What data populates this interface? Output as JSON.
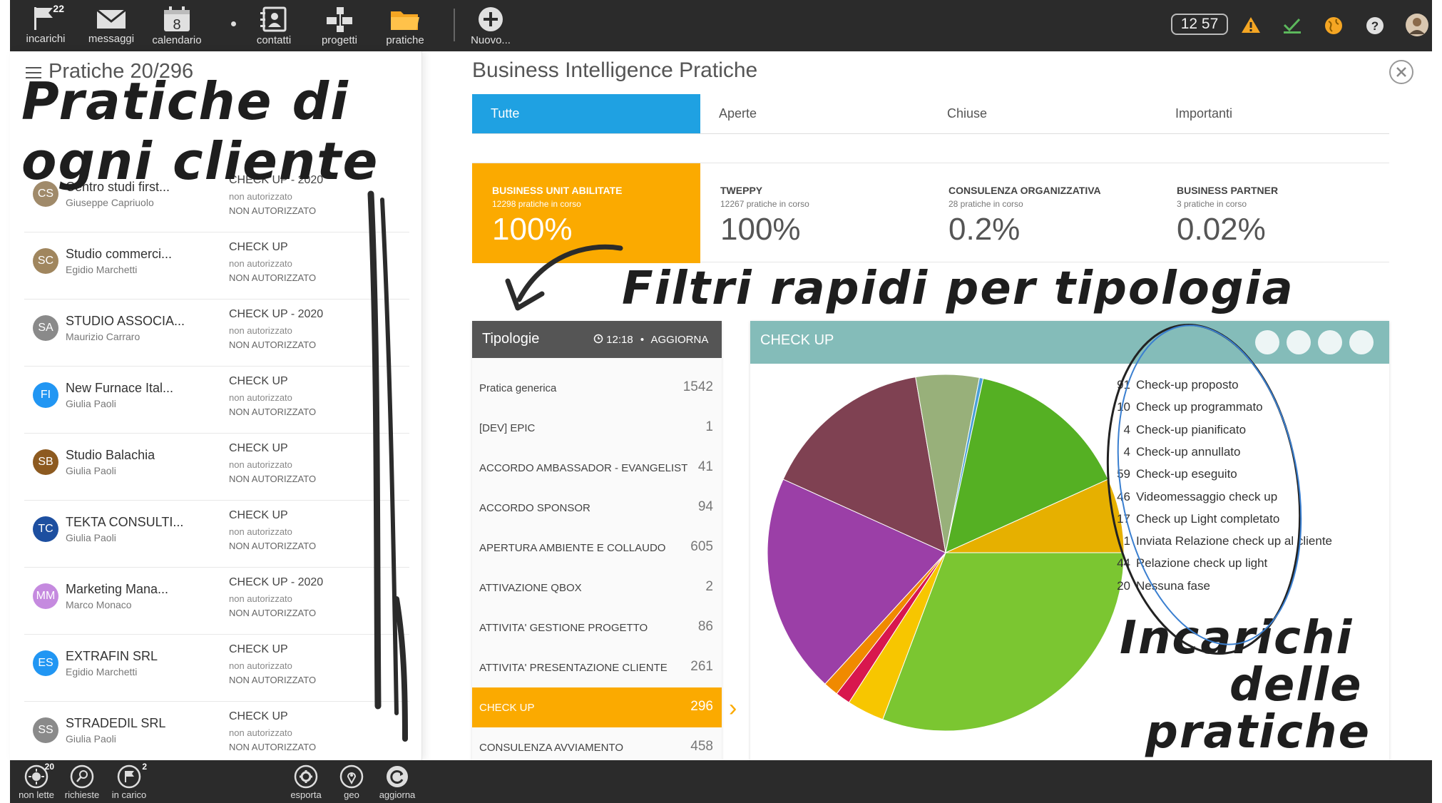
{
  "topbar": {
    "items": [
      {
        "label": "incarichi",
        "icon": "flag-icon",
        "badge": "22"
      },
      {
        "label": "messaggi",
        "icon": "envelope-icon"
      },
      {
        "label": "calendario",
        "icon": "calendar-icon",
        "day": "8"
      },
      {
        "label": "contatti",
        "icon": "contacts-icon"
      },
      {
        "label": "progetti",
        "icon": "projects-icon"
      },
      {
        "label": "pratiche",
        "icon": "folder-icon"
      },
      {
        "label": "Nuovo...",
        "icon": "plus-icon"
      }
    ],
    "clock": "12 57"
  },
  "left": {
    "title": "Pratiche 20/296",
    "clients": [
      {
        "initials": "CS",
        "color": "#a08a6a",
        "name": "Centro studi first...",
        "contact": "Giuseppe Capriuolo",
        "type": "CHECK UP - 2020",
        "sub": "non autorizzato",
        "status": "NON AUTORIZZATO"
      },
      {
        "initials": "SC",
        "color": "#a0865e",
        "name": "Studio commerci...",
        "contact": "Egidio Marchetti",
        "type": "CHECK UP",
        "sub": "non autorizzato",
        "status": "NON AUTORIZZATO"
      },
      {
        "initials": "SA",
        "color": "#8a8a8a",
        "name": "STUDIO ASSOCIA...",
        "contact": "Maurizio Carraro",
        "type": "CHECK UP - 2020",
        "sub": "non autorizzato",
        "status": "NON AUTORIZZATO"
      },
      {
        "initials": "FI",
        "color": "#2196f3",
        "name": "New Furnace Ital...",
        "contact": "Giulia Paoli",
        "type": "CHECK UP",
        "sub": "non autorizzato",
        "status": "NON AUTORIZZATO"
      },
      {
        "initials": "SB",
        "color": "#8d5a20",
        "name": "Studio Balachia",
        "contact": "Giulia Paoli",
        "type": "CHECK UP",
        "sub": "non autorizzato",
        "status": "NON AUTORIZZATO"
      },
      {
        "initials": "TC",
        "color": "#1d4fa0",
        "name": "TEKTA CONSULTI...",
        "contact": "Giulia Paoli",
        "type": "CHECK UP",
        "sub": "non autorizzato",
        "status": "NON AUTORIZZATO"
      },
      {
        "initials": "MM",
        "color": "#c58adf",
        "name": "Marketing Mana...",
        "contact": "Marco Monaco",
        "type": "CHECK UP - 2020",
        "sub": "non autorizzato",
        "status": "NON AUTORIZZATO"
      },
      {
        "initials": "ES",
        "color": "#2196f3",
        "name": "EXTRAFIN SRL",
        "contact": "Egidio Marchetti",
        "type": "CHECK UP",
        "sub": "non autorizzato",
        "status": "NON AUTORIZZATO"
      },
      {
        "initials": "SS",
        "color": "#8a8a8a",
        "name": "STRADEDIL SRL",
        "contact": "Giulia Paoli",
        "type": "CHECK UP",
        "sub": "non autorizzato",
        "status": "NON AUTORIZZATO"
      }
    ]
  },
  "main": {
    "title": "Business Intelligence Pratiche",
    "tabs": [
      "Tutte",
      "Aperte",
      "Chiuse",
      "Importanti"
    ],
    "cards": [
      {
        "label": "BUSINESS UNIT ABILITATE",
        "sub": "12298 pratiche in corso",
        "value": "100%"
      },
      {
        "label": "TWEPPY",
        "sub": "12267 pratiche in corso",
        "value": "100%"
      },
      {
        "label": "CONSULENZA ORGANIZZATIVA",
        "sub": "28 pratiche in corso",
        "value": "0.2%"
      },
      {
        "label": "BUSINESS PARTNER",
        "sub": "3 pratiche in corso",
        "value": "0.02%"
      }
    ]
  },
  "tipologie": {
    "title": "Tipologie",
    "time": "12:18",
    "refresh": "AGGIORNA",
    "items": [
      {
        "name": "Pratica generica",
        "count": "1542"
      },
      {
        "name": "[DEV] EPIC",
        "count": "1"
      },
      {
        "name": "ACCORDO AMBASSADOR - EVANGELIST",
        "count": "41"
      },
      {
        "name": "ACCORDO SPONSOR",
        "count": "94"
      },
      {
        "name": "APERTURA AMBIENTE E COLLAUDO",
        "count": "605"
      },
      {
        "name": "ATTIVAZIONE QBOX",
        "count": "2"
      },
      {
        "name": "ATTIVITA' GESTIONE PROGETTO",
        "count": "86"
      },
      {
        "name": "ATTIVITA' PRESENTAZIONE CLIENTE",
        "count": "261"
      },
      {
        "name": "CHECK UP",
        "count": "296"
      },
      {
        "name": "CONSULENZA AVVIAMENTO",
        "count": "458"
      }
    ]
  },
  "chart_panel": {
    "title": "CHECK UP"
  },
  "chart_data": {
    "type": "pie",
    "title": "",
    "categories": [
      "Check-up proposto",
      "Check up programmato",
      "Check-up pianificato",
      "Check-up annullato",
      "Check-up eseguito",
      "Videomessaggio check up",
      "Check up Light completato",
      "Inviata Relazione check up al cliente",
      "Relazione check up light",
      "Nessuna fase"
    ],
    "values": [
      91,
      10,
      4,
      4,
      59,
      46,
      17,
      1,
      44,
      20
    ],
    "colors": [
      "#7bc631",
      "#f7c600",
      "#d8174e",
      "#f08a00",
      "#9b3fa7",
      "#7f4152",
      "#98b07a",
      "#4aa0d8",
      "#55b023",
      "#e6b000"
    ],
    "legend": "right"
  },
  "bottombar": {
    "items": [
      {
        "label": "non lette",
        "badge": "20"
      },
      {
        "label": "richieste"
      },
      {
        "label": "in carico",
        "badge": "2"
      },
      {
        "label": "esporta"
      },
      {
        "label": "geo"
      },
      {
        "label": "aggiorna"
      }
    ]
  },
  "annotations": {
    "a1_line1": "Pratiche di",
    "a1_line2": "ogni cliente",
    "a2": "Filtri rapidi per tipologia",
    "a3_line1": "Incarichi",
    "a3_line2": "delle",
    "a3_line3": "pratiche"
  }
}
